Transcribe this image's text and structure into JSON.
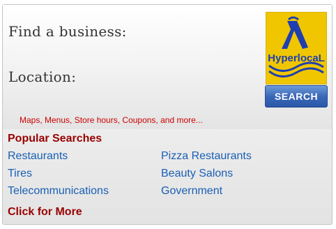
{
  "search": {
    "business_label": "Find a business:",
    "location_label": "Location:",
    "button_label": "SEARCH"
  },
  "logo": {
    "text": "HyperlocaL",
    "icon": "hyperlocal-logo-icon"
  },
  "tagline": "Maps, Menus, Store hours, Coupons, and more...",
  "popular": {
    "heading": "Popular Searches",
    "links": [
      "Restaurants",
      "Pizza Restaurants",
      "Tires",
      "Beauty Salons",
      "Telecommunications",
      "Government"
    ],
    "more_label": "Click for More"
  },
  "colors": {
    "link": "#1a5fb4",
    "heading": "#990000",
    "tagline": "#cc0000",
    "button": "#3a68b8",
    "logo_bg": "#f0c600"
  }
}
